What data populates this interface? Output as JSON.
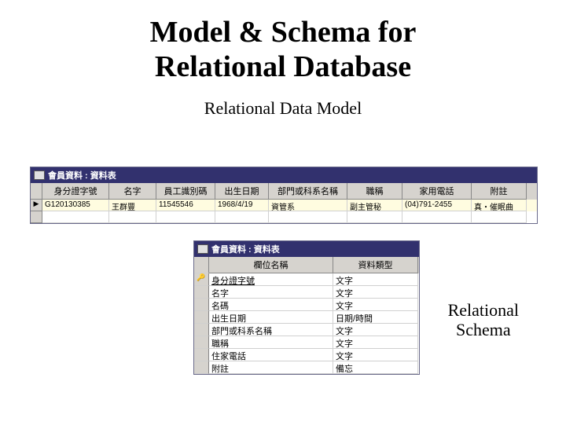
{
  "title_line1": "Model & Schema for",
  "title_line2": "Relational Database",
  "subtitle": "Relational Data Model",
  "schema_label_line1": "Relational",
  "schema_label_line2": "Schema",
  "datasheet": {
    "window_title": "會員資料 : 資料表",
    "columns": [
      "身分證字號",
      "名字",
      "員工識別碼",
      "出生日期",
      "部門或科系名稱",
      "職稱",
      "家用電話",
      "附註"
    ],
    "row1": [
      "G120130385",
      "王群豐",
      "11545546",
      "1968/4/19",
      "資管系",
      "副主管秘",
      "(04)791-2455",
      "真‧催眠曲"
    ]
  },
  "design": {
    "window_title": "會員資料 : 資料表",
    "header_field": "欄位名稱",
    "header_type": "資料類型",
    "fields": [
      {
        "name": "身分證字號",
        "type": "文字",
        "pk": true
      },
      {
        "name": "名字",
        "type": "文字",
        "pk": false
      },
      {
        "name": "名碼",
        "type": "文字",
        "pk": false
      },
      {
        "name": "出生日期",
        "type": "日期/時間",
        "pk": false
      },
      {
        "name": "部門或科系名稱",
        "type": "文字",
        "pk": false
      },
      {
        "name": "職稱",
        "type": "文字",
        "pk": false
      },
      {
        "name": "住家電話",
        "type": "文字",
        "pk": false
      },
      {
        "name": "附註",
        "type": "備忘",
        "pk": false
      }
    ]
  }
}
